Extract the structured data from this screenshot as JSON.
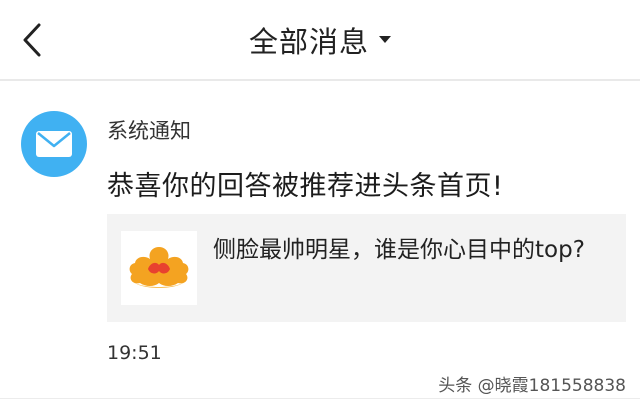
{
  "header": {
    "title": "全部消息",
    "back_icon": "chevron-left-icon",
    "dropdown_icon": "caret-down-icon"
  },
  "message": {
    "avatar_icon": "mail-icon",
    "sender": "系统通知",
    "text": "恭喜你的回答被推荐进头条首页!",
    "card": {
      "thumbnail_icon": "toutiao-cloud-logo-icon",
      "title": "侧脸最帅明星，谁是你心目中的top?"
    },
    "time": "19:51"
  },
  "watermark": "头条 @晓霞181558838",
  "colors": {
    "avatar_bg": "#40b1f2",
    "card_bg": "#f3f3f3",
    "logo_orange": "#f4a321",
    "logo_red": "#e8412f"
  }
}
